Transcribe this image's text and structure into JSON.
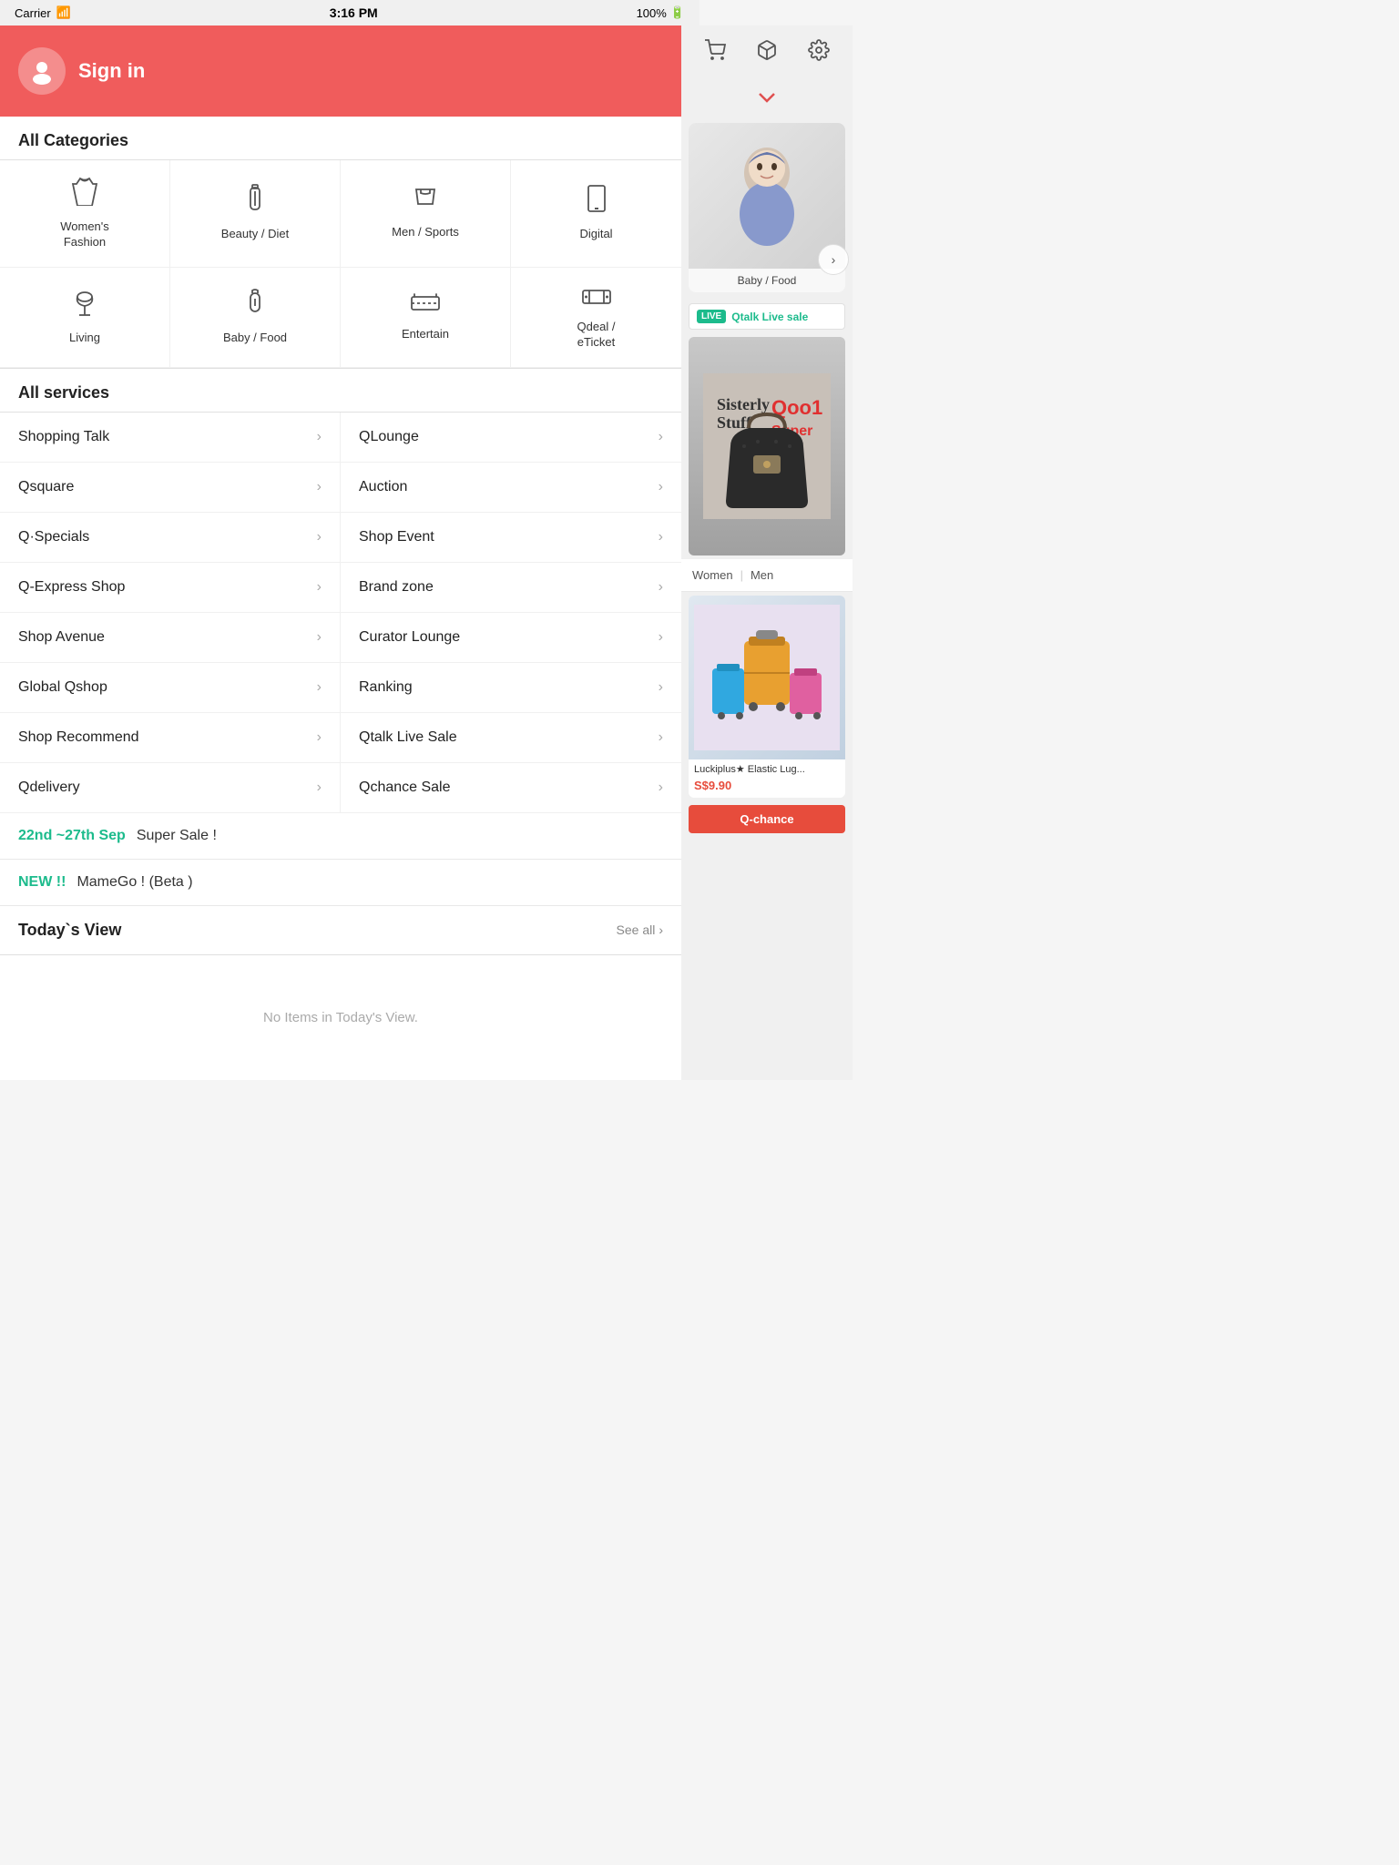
{
  "statusBar": {
    "carrier": "Carrier",
    "wifi": "wifi",
    "time": "3:16 PM",
    "battery": "100%"
  },
  "header": {
    "signinLabel": "Sign in",
    "avatarIcon": "person"
  },
  "rightPanelIcons": [
    {
      "name": "cart-icon",
      "symbol": "🛒"
    },
    {
      "name": "box-icon",
      "symbol": "📦"
    },
    {
      "name": "settings-icon",
      "symbol": "⚙️"
    }
  ],
  "categories": {
    "title": "All Categories",
    "items": [
      {
        "name": "women-fashion",
        "label": "Women's\nFashion",
        "icon": "👗"
      },
      {
        "name": "beauty-diet",
        "label": "Beauty / Diet",
        "icon": "💄"
      },
      {
        "name": "men-sports",
        "label": "Men / Sports",
        "icon": "👕"
      },
      {
        "name": "digital",
        "label": "Digital",
        "icon": "📱"
      },
      {
        "name": "living",
        "label": "Living",
        "icon": "🪔"
      },
      {
        "name": "baby-food",
        "label": "Baby / Food",
        "icon": "🍼"
      },
      {
        "name": "entertain",
        "label": "Entertain",
        "icon": "🎫"
      },
      {
        "name": "qdeal",
        "label": "Qdeal /\neTicket",
        "icon": "🎟️"
      }
    ]
  },
  "services": {
    "title": "All services",
    "items": [
      {
        "name": "shopping-talk",
        "label": "Shopping Talk"
      },
      {
        "name": "qlounge",
        "label": "QLounge"
      },
      {
        "name": "qsquare",
        "label": "Qsquare"
      },
      {
        "name": "auction",
        "label": "Auction"
      },
      {
        "name": "q-specials",
        "label": "Q·Specials"
      },
      {
        "name": "shop-event",
        "label": "Shop Event"
      },
      {
        "name": "q-express-shop",
        "label": "Q-Express Shop"
      },
      {
        "name": "brand-zone",
        "label": "Brand zone"
      },
      {
        "name": "shop-avenue",
        "label": "Shop Avenue"
      },
      {
        "name": "curator-lounge",
        "label": "Curator Lounge"
      },
      {
        "name": "global-qshop",
        "label": "Global Qshop"
      },
      {
        "name": "ranking",
        "label": "Ranking"
      },
      {
        "name": "shop-recommend",
        "label": "Shop Recommend"
      },
      {
        "name": "qtalk-live-sale",
        "label": "Qtalk Live Sale"
      },
      {
        "name": "qdelivery",
        "label": "Qdelivery"
      },
      {
        "name": "qchance-sale",
        "label": "Qchance Sale"
      }
    ]
  },
  "promos": [
    {
      "date": "22nd ~27th Sep",
      "text": "Super Sale !",
      "type": "date"
    },
    {
      "badge": "NEW !!",
      "text": "MameGo ! (Beta )",
      "type": "new"
    }
  ],
  "todaysView": {
    "title": "Today`s View",
    "seeAll": "See all",
    "empty": "No Items in Today's View."
  },
  "rightPanel": {
    "babyFood": {
      "label": "Baby / Food",
      "emoji": "👶"
    },
    "qtalk": {
      "badge": "LIVE",
      "text": "Qtalk Live sale"
    },
    "genderTabs": {
      "women": "Women",
      "men": "Men"
    },
    "product": {
      "name": "Luckiplus★ Elastic Lug...",
      "price": "S$9.90",
      "emoji": "🧳"
    },
    "qchance": "Q-chance"
  }
}
